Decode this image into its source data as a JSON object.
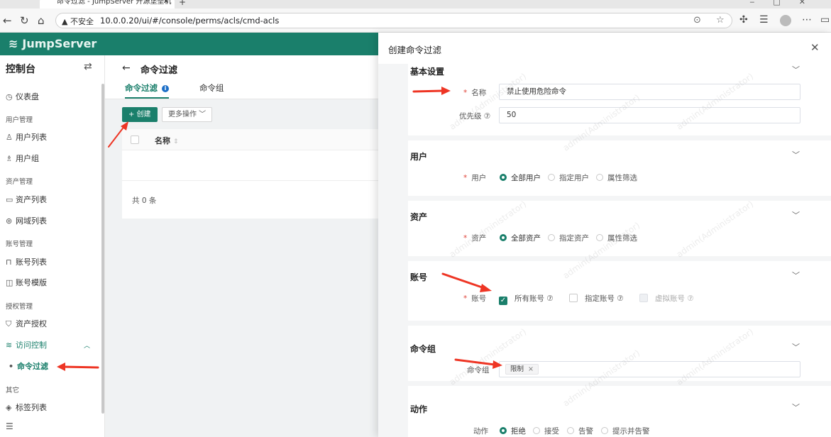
{
  "browser": {
    "tab_title": "命令过滤 - JumpServer 开源堡垒机",
    "tab_close": "✕",
    "new_tab": "+",
    "insecure_label": "▲ 不安全",
    "url": "10.0.0.20/ui/#/console/perms/acls/cmd-acls"
  },
  "app": {
    "logo_text": "JumpServer"
  },
  "sidebar": {
    "title": "控制台",
    "items": [
      {
        "type": "item",
        "label": "仪表盘"
      },
      {
        "type": "group",
        "label": "用户管理"
      },
      {
        "type": "item",
        "label": "用户列表"
      },
      {
        "type": "item",
        "label": "用户组"
      },
      {
        "type": "group",
        "label": "资产管理"
      },
      {
        "type": "item",
        "label": "资产列表"
      },
      {
        "type": "item",
        "label": "网域列表"
      },
      {
        "type": "group",
        "label": "账号管理"
      },
      {
        "type": "item",
        "label": "账号列表"
      },
      {
        "type": "item",
        "label": "账号模版"
      },
      {
        "type": "group",
        "label": "授权管理"
      },
      {
        "type": "item",
        "label": "资产授权"
      },
      {
        "type": "item",
        "label": "访问控制"
      },
      {
        "type": "item",
        "label": "命令过滤"
      },
      {
        "type": "group",
        "label": "其它"
      },
      {
        "type": "item",
        "label": "标签列表"
      }
    ]
  },
  "main": {
    "page_title": "命令过滤",
    "tabs": [
      {
        "label": "命令过滤"
      },
      {
        "label": "命令组"
      }
    ],
    "create_label": "+ 创建",
    "more_label": "更多操作 ﹀",
    "table": {
      "columns": [
        "名称"
      ],
      "rows": [],
      "total_text": "共 0 条"
    }
  },
  "drawer": {
    "title": "创建命令过滤",
    "close": "✕",
    "sections": {
      "basic": {
        "title": "基本设置",
        "name_label": "名称",
        "name_value": "禁止使用危险命令",
        "priority_label": "优先级 ⑦",
        "priority_value": "50"
      },
      "users": {
        "title": "用户",
        "field_label": "用户",
        "options": [
          "全部用户",
          "指定用户",
          "属性筛选"
        ],
        "selected": "全部用户"
      },
      "assets": {
        "title": "资产",
        "field_label": "资产",
        "options": [
          "全部资产",
          "指定资产",
          "属性筛选"
        ],
        "selected": "全部资产"
      },
      "accounts": {
        "title": "账号",
        "field_label": "账号",
        "options": [
          "所有账号 ⑦",
          "指定账号 ⑦",
          "虚拟账号 ⑦"
        ],
        "checked": [
          "所有账号 ⑦"
        ],
        "disabled": [
          "虚拟账号 ⑦"
        ]
      },
      "command_groups": {
        "title": "命令组",
        "field_label": "命令组",
        "tags": [
          "限制"
        ]
      },
      "action": {
        "title": "动作",
        "field_label": "动作",
        "options": [
          "拒绝",
          "接受",
          "告警",
          "提示并告警"
        ],
        "selected": "拒绝"
      }
    }
  },
  "watermark_text": "admin(Administrator)",
  "colors": {
    "primary": "#1a7f6b",
    "required": "#e0453a",
    "annotation": "#ee3524"
  }
}
